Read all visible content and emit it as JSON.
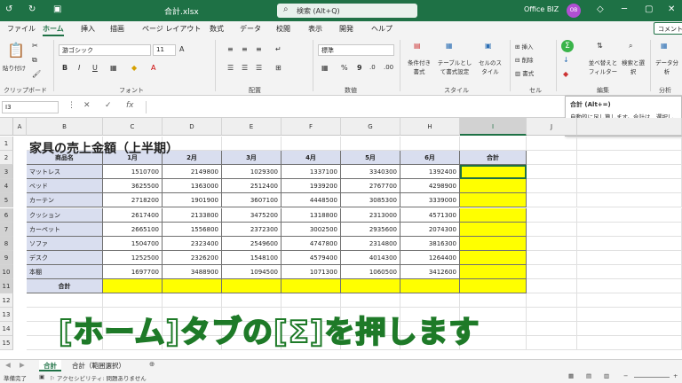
{
  "titlebar": {
    "filename": "合計.xlsx",
    "search_placeholder": "検索 (Alt+Q)",
    "user": "Office BIZ",
    "avatar_initials": "OB",
    "color": "#1e7145"
  },
  "menu": {
    "tabs": [
      "ファイル",
      "ホーム",
      "挿入",
      "描画",
      "ページ レイアウト",
      "数式",
      "データ",
      "校閲",
      "表示",
      "開発",
      "ヘルプ"
    ],
    "active": "ホーム",
    "comment": "コメント"
  },
  "ribbon": {
    "groups": [
      "クリップボード",
      "フォント",
      "配置",
      "数値",
      "スタイル",
      "セル",
      "編集",
      "分析"
    ],
    "paste": "貼り付け",
    "font_name": "游ゴシック",
    "font_size": "11",
    "number_format": "標準",
    "style_buttons": [
      "条件付き書式",
      "テーブルとして書式設定",
      "セルのスタイル"
    ],
    "cell_buttons": [
      "挿入",
      "削除",
      "書式"
    ],
    "edit_buttons": [
      "並べ替えとフィルター",
      "検索と選択"
    ],
    "analysis": "データ分析"
  },
  "tooltip": {
    "title": "合計 (Alt+=)",
    "body": "自動的に足し算します。合計は、選択したセルの後に表示されます。"
  },
  "formula": {
    "namebox": "I3",
    "value": ""
  },
  "sheet": {
    "columns": [
      "A",
      "B",
      "C",
      "D",
      "E",
      "F",
      "G",
      "H",
      "I",
      "J"
    ],
    "selected_column": "I",
    "title": "家具の売上金額（上半期）",
    "headers": [
      "商品名",
      "1月",
      "2月",
      "3月",
      "4月",
      "5月",
      "6月",
      "合計"
    ],
    "rows": [
      {
        "name": "マットレス",
        "values": [
          "1510700",
          "2149800",
          "1029300",
          "1337100",
          "3340300",
          "1392400"
        ]
      },
      {
        "name": "ベッド",
        "values": [
          "3625500",
          "1363000",
          "2512400",
          "1939200",
          "2767700",
          "4298900"
        ]
      },
      {
        "name": "カーテン",
        "values": [
          "2718200",
          "1901900",
          "3607100",
          "4448500",
          "3085300",
          "3339000"
        ]
      },
      {
        "name": "クッション",
        "values": [
          "2617400",
          "2133800",
          "3475200",
          "1318800",
          "2313000",
          "4571300"
        ]
      },
      {
        "name": "カーペット",
        "values": [
          "2665100",
          "1556800",
          "2372300",
          "3002500",
          "2935600",
          "2074300"
        ]
      },
      {
        "name": "ソファ",
        "values": [
          "1504700",
          "2323400",
          "2549600",
          "4747800",
          "2314800",
          "3816300"
        ]
      },
      {
        "name": "デスク",
        "values": [
          "1252500",
          "2326200",
          "1548100",
          "4579400",
          "4014300",
          "1264400"
        ]
      },
      {
        "name": "本棚",
        "values": [
          "1697700",
          "3488900",
          "1094500",
          "1071300",
          "1060500",
          "3412600"
        ]
      }
    ],
    "total_label": "合計",
    "row_numbers": [
      "1",
      "2",
      "3",
      "4",
      "5",
      "6",
      "7",
      "8",
      "9",
      "10",
      "11",
      "12",
      "13",
      "14",
      "15"
    ]
  },
  "caption": "[ホーム]タブの[Σ]を押します",
  "sheet_tabs": [
    "合計",
    "合計（範囲選択）"
  ],
  "status": {
    "ready": "準備完了",
    "accessibility": "アクセシビリティ: 問題ありません"
  }
}
